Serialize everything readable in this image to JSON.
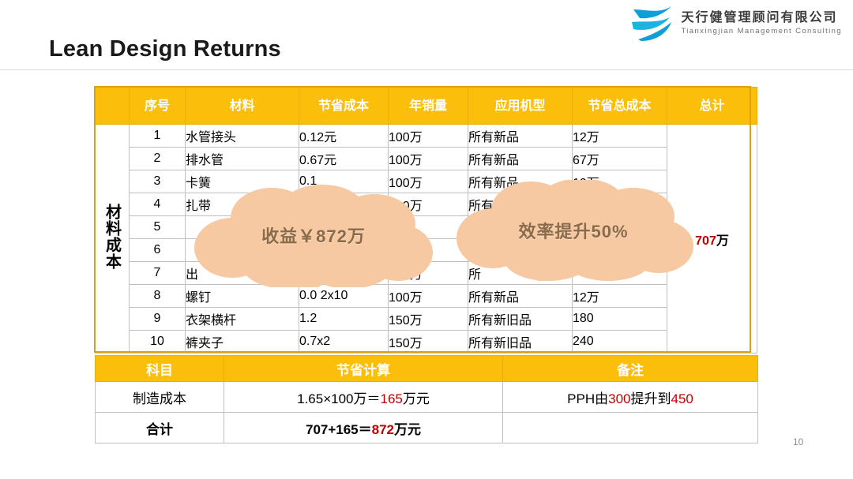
{
  "logo": {
    "icon": "swoosh-logo-icon",
    "chinese_name": "天行健管理顾问有限公司",
    "english_name": "Tianxingjian Management Consulting",
    "mark_color": "#0f9ed5"
  },
  "slide": {
    "title": "Lean Design Returns",
    "page_number": "10"
  },
  "main_table": {
    "row_group_label": "材料成本",
    "headers": {
      "corner": "",
      "index": "序号",
      "material": "材料",
      "saving": "节省成本",
      "volume": "年销量",
      "model": "应用机型",
      "total_saving": "节省总成本",
      "grand_total": "总计"
    },
    "grand_total_value": "707",
    "grand_total_unit": "万",
    "rows": [
      {
        "index": "1",
        "material": "水管接头",
        "saving": "0.12元",
        "volume": "100万",
        "model": "所有新品",
        "total_saving": "12万"
      },
      {
        "index": "2",
        "material": "排水管",
        "saving": "0.67元",
        "volume": "100万",
        "model": "所有新品",
        "total_saving": "67万"
      },
      {
        "index": "3",
        "material": "卡簧",
        "saving": "0.1",
        "volume": "100万",
        "model": "所有新品",
        "total_saving": "10万"
      },
      {
        "index": "4",
        "material": "扎带",
        "saving": "",
        "volume": "100万",
        "model": "所有新品",
        "total_saving": ""
      },
      {
        "index": "5",
        "material": "",
        "saving": "",
        "volume": "万",
        "model": "",
        "total_saving": ""
      },
      {
        "index": "6",
        "material": "",
        "saving": "",
        "volume": "万",
        "model": "",
        "total_saving": ""
      },
      {
        "index": "7",
        "material": "出",
        "saving": "",
        "volume": "100万",
        "model": "所",
        "total_saving": ""
      },
      {
        "index": "8",
        "material": "螺钉",
        "saving": "0.0 2x10",
        "volume": "100万",
        "model": "所有新品",
        "total_saving": "12万"
      },
      {
        "index": "9",
        "material": "衣架横杆",
        "saving": "1.2",
        "volume": "150万",
        "model": "所有新旧品",
        "total_saving": "180"
      },
      {
        "index": "10",
        "material": "裤夹子",
        "saving": "0.7x2",
        "volume": "150万",
        "model": "所有新旧品",
        "total_saving": "240"
      }
    ]
  },
  "bottom_table": {
    "headers": {
      "subject": "科目",
      "calculation": "节省计算",
      "remark": "备注"
    },
    "rows": [
      {
        "subject": "制造成本",
        "calc_prefix": "1.65×100万＝",
        "calc_highlight": "165",
        "calc_suffix": "万元",
        "remark_prefix": "PPH由",
        "remark_h1": "300",
        "remark_mid": "提升到",
        "remark_h2": "450",
        "remark_suffix": "",
        "bold": false
      },
      {
        "subject": "合计",
        "calc_prefix": "707+165＝",
        "calc_highlight": "872",
        "calc_suffix": "万元",
        "remark_prefix": "",
        "remark_h1": "",
        "remark_mid": "",
        "remark_h2": "",
        "remark_suffix": "",
        "bold": true
      }
    ]
  },
  "callouts": [
    {
      "name": "cloud-benefit",
      "text": "收益￥872万"
    },
    {
      "name": "cloud-efficiency",
      "text": "效率提升50%"
    }
  ],
  "colors": {
    "header_gold": "#FBBE0A",
    "cloud_fill": "#F6C9A2",
    "cloud_text": "#8a6a48",
    "accent_red": "#c00000",
    "frame_gold": "#d9a407"
  }
}
